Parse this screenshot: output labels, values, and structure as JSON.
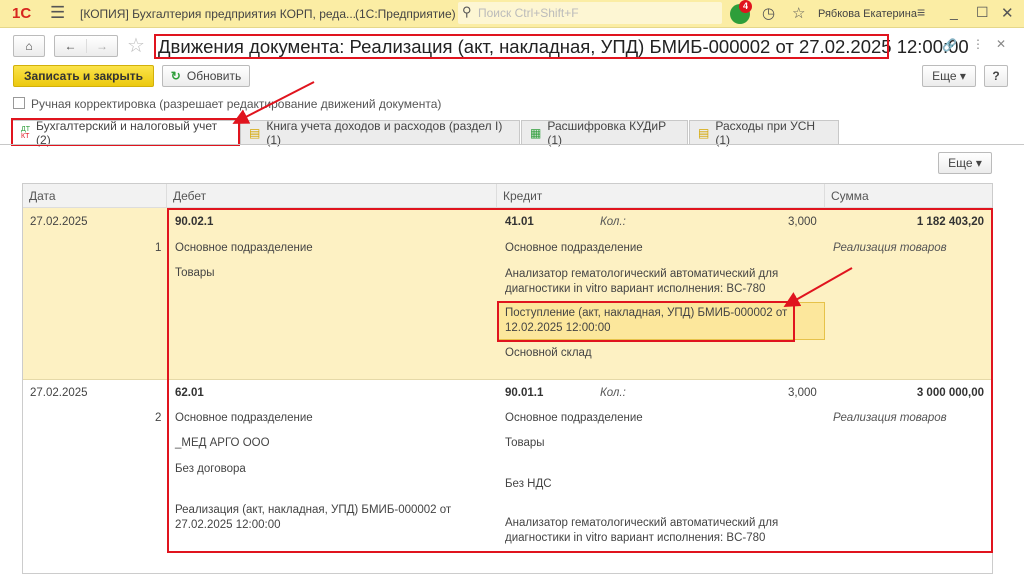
{
  "topbar": {
    "logo": "1С",
    "title": "[КОПИЯ] Бухгалтерия предприятия КОРП, реда...",
    "app": "(1С:Предприятие)",
    "search_placeholder": "Поиск Ctrl+Shift+F",
    "notifications": "4",
    "user": "Рябкова Екатерина"
  },
  "window": {
    "title": "Движения документа: Реализация (акт, накладная, УПД) БМИБ-000002 от 27.02.2025 12:00:00"
  },
  "toolbar": {
    "save_close": "Записать и закрыть",
    "refresh": "Обновить",
    "more": "Еще",
    "help": "?"
  },
  "manual": {
    "label": "Ручная корректировка (разрешает редактирование движений документа)",
    "checked": false
  },
  "tabs": [
    {
      "label": "Бухгалтерский и налоговый учет (2)",
      "icon": "dt-kt-icon",
      "active": true
    },
    {
      "label": "Книга учета доходов и расходов (раздел I) (1)",
      "icon": "book-icon"
    },
    {
      "label": "Расшифровка КУДиР (1)",
      "icon": "table-icon"
    },
    {
      "label": "Расходы при УСН (1)",
      "icon": "book-icon"
    }
  ],
  "table": {
    "more": "Еще",
    "columns": [
      "Дата",
      "Дебет",
      "Кредит",
      "Сумма"
    ],
    "rows": [
      {
        "date": "27.02.2025",
        "num": "1",
        "debit": {
          "account": "90.02.1",
          "sub": [
            "Основное подразделение",
            "Товары"
          ]
        },
        "credit": {
          "account": "41.01",
          "qty_label": "Кол.:",
          "qty": "3,000",
          "sub": [
            "Основное подразделение",
            "Анализатор гематологический автоматический для диагностики in vitro вариант исполнения: BC-780",
            "Поступление (акт, накладная, УПД) БМИБ-000002 от 12.02.2025 12:00:00",
            "Основной склад"
          ]
        },
        "sum": "1 182 403,20",
        "content": "Реализация товаров"
      },
      {
        "date": "27.02.2025",
        "num": "2",
        "debit": {
          "account": "62.01",
          "sub": [
            "Основное подразделение",
            "_МЕД АРГО ООО",
            "Без договора",
            "Реализация (акт, накладная, УПД) БМИБ-000002 от 27.02.2025 12:00:00"
          ]
        },
        "credit": {
          "account": "90.01.1",
          "qty_label": "Кол.:",
          "qty": "3,000",
          "sub": [
            "Основное подразделение",
            "Товары",
            "Без НДС",
            "Анализатор гематологический автоматический для диагностики in vitro вариант исполнения: BC-780"
          ]
        },
        "sum": "3 000 000,00",
        "content": "Реализация товаров"
      }
    ]
  },
  "colors": {
    "accent": "#f5d327",
    "highlight": "#e0141e",
    "row_selected": "#fdf1c3"
  }
}
